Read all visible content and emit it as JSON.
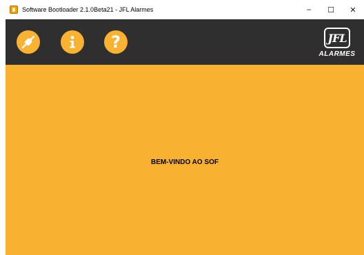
{
  "window": {
    "title": "Software Bootloader 2.1.0Beta21 - JFL Alarmes",
    "controls": {
      "minimize": "–",
      "maximize": "☐",
      "close": "✕"
    }
  },
  "toolbar": {
    "buttons": [
      {
        "name": "connect",
        "icon": "plug-icon"
      },
      {
        "name": "info",
        "icon": "info-icon",
        "glyph": "i"
      },
      {
        "name": "help",
        "icon": "question-icon",
        "glyph": "?"
      }
    ],
    "logo": {
      "mark": "JFL",
      "subtitle": "ALARMES"
    }
  },
  "main": {
    "welcome_text": "BEM-VINDO AO SOF"
  },
  "colors": {
    "accent": "#f9b132",
    "toolbar_bg": "#2f2f2f",
    "text": "#000000"
  }
}
